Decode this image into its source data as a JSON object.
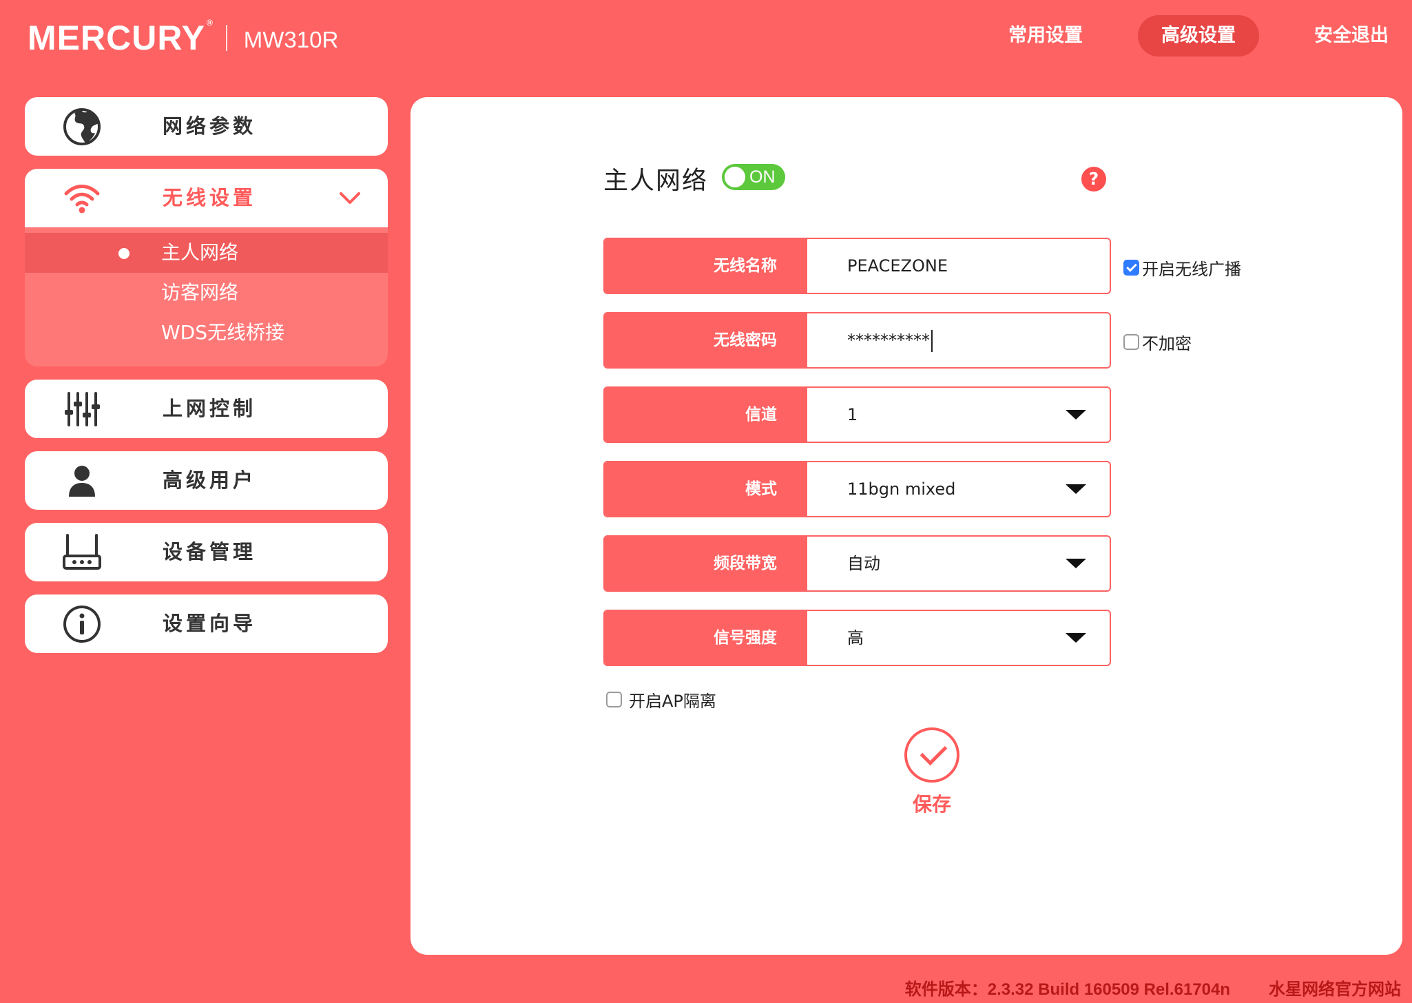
{
  "brand": {
    "logo": "MERCURY",
    "registered": "®",
    "model": "MW310R"
  },
  "topnav": [
    {
      "label": "常用设置",
      "active": false
    },
    {
      "label": "高级设置",
      "active": true
    },
    {
      "label": "安全退出",
      "active": false
    }
  ],
  "sidebar": {
    "items": [
      {
        "label": "网络参数",
        "icon": "globe-icon"
      },
      {
        "label": "无线设置",
        "icon": "wifi-icon",
        "expanded": true
      },
      {
        "label": "上网控制",
        "icon": "sliders-icon"
      },
      {
        "label": "高级用户",
        "icon": "user-icon"
      },
      {
        "label": "设备管理",
        "icon": "router-icon"
      },
      {
        "label": "设置向导",
        "icon": "info-icon"
      }
    ],
    "wireless_sub": [
      {
        "label": "主人网络",
        "active": true
      },
      {
        "label": "访客网络",
        "active": false
      },
      {
        "label": "WDS无线桥接",
        "active": false
      }
    ]
  },
  "main": {
    "title": "主人网络",
    "toggle_label": "ON",
    "help": "?",
    "fields": {
      "ssid": {
        "label": "无线名称",
        "value": "PEACEZONE"
      },
      "password": {
        "label": "无线密码",
        "value": "**********"
      },
      "channel": {
        "label": "信道",
        "value": "1"
      },
      "mode": {
        "label": "模式",
        "value": "11bgn mixed"
      },
      "bandwidth": {
        "label": "频段带宽",
        "value": "自动"
      },
      "signal": {
        "label": "信号强度",
        "value": "高"
      }
    },
    "broadcast": {
      "label": "开启无线广播",
      "checked": true
    },
    "no_encrypt": {
      "label": "不加密",
      "checked": false
    },
    "ap_isolation": {
      "label": "开启AP隔离",
      "checked": false
    },
    "save_label": "保存"
  },
  "footer": {
    "version": "软件版本：2.3.32 Build 160509 Rel.61704n",
    "link": "水星网络官方网站"
  },
  "colors": {
    "background": "#ff6262",
    "accent": "#ff5a5a",
    "toggle_on": "#5cc83c",
    "checkbox_checked": "#2f7bff"
  }
}
